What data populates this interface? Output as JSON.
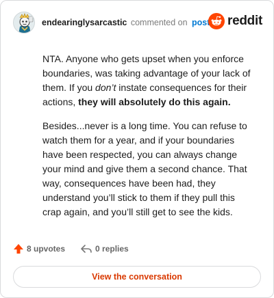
{
  "header": {
    "username": "endearinglysarcastic",
    "commented_text": "commented on",
    "post_link": "post",
    "brand": "reddit"
  },
  "comment": {
    "p1_a": "NTA. Anyone who gets upset when you enforce boundaries, was taking advantage of your lack of them. If you ",
    "p1_em": "don’t",
    "p1_b": " instate consequences for their actions, ",
    "p1_strong": "they will absolutely do this again.",
    "p2": "Besides...never is a long time. You can refuse to watch them for a year, and if your boundaries have been respected, you can always change your mind and give them a second chance. That way, consequences have been had, they understand you’ll stick to them if they pull this crap again, and you’ll still get to see the kids."
  },
  "footer": {
    "upvotes": "8 upvotes",
    "replies": "0 replies",
    "view_button": "View the conversation"
  },
  "colors": {
    "accent": "#d93900",
    "link": "#0079d3",
    "upvote": "#ff4500"
  },
  "icons": {
    "avatar": "snoo-avatar",
    "brand": "reddit-logo-icon",
    "upvote": "upvote-arrow-icon",
    "reply": "reply-arrow-icon"
  }
}
